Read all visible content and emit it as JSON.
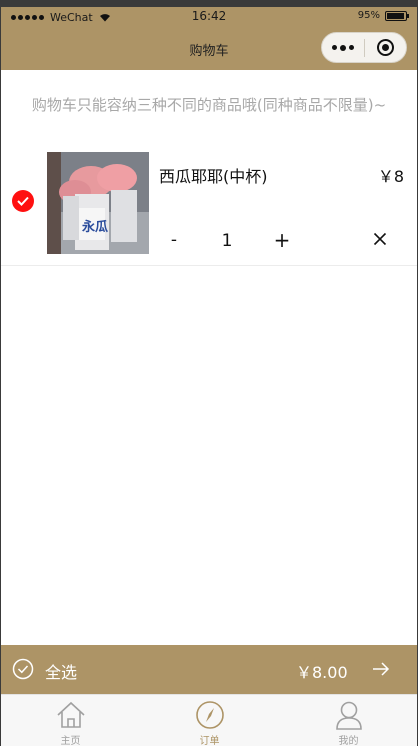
{
  "status_bar": {
    "carrier": "WeChat",
    "time": "16:42",
    "battery": "95%",
    "battery_level": 0.95
  },
  "nav": {
    "title": "购物车"
  },
  "notice": "购物车只能容纳三种不同的商品哦(同种商品不限量)~",
  "cart": {
    "items": [
      {
        "name": "西瓜耶耶(中杯)",
        "price": "￥8",
        "quantity": "1",
        "minus_label": "-",
        "plus_label": "+",
        "selected": true,
        "image_text": "永瓜"
      }
    ]
  },
  "checkout": {
    "select_all_label": "全选",
    "total": "￥8.00"
  },
  "tabbar": {
    "items": [
      {
        "label": "主页",
        "icon": "home-icon"
      },
      {
        "label": "订单",
        "icon": "compass-icon"
      },
      {
        "label": "我的",
        "icon": "user-icon"
      }
    ]
  },
  "colors": {
    "brand": "#ad9466",
    "selected_check": "#ff1010",
    "notice_text": "#a8a8a8",
    "tab_inactive": "#a0a0a0"
  }
}
